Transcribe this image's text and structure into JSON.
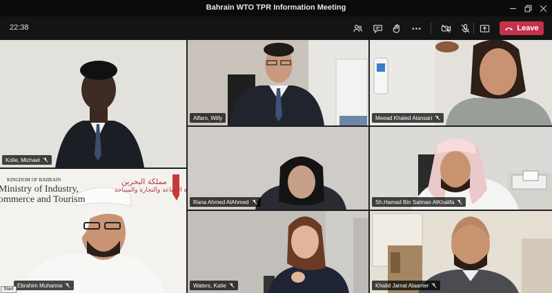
{
  "window": {
    "title": "Bahrain WTO TPR Information Meeting"
  },
  "toolbar": {
    "clock": "22:38",
    "leave_label": "Leave",
    "icons": [
      "people-icon",
      "chat-icon",
      "raise-hand-icon",
      "more-icon",
      "camera-off-icon",
      "mic-off-icon",
      "share-screen-icon",
      "phone-icon"
    ],
    "leave_color": "#c4314b"
  },
  "participants": [
    {
      "name": "Kolie, Michael",
      "muted": true
    },
    {
      "name": "Alfaro, Willy",
      "muted": false
    },
    {
      "name": "Meead Khaled Alansari",
      "muted": true
    },
    {
      "name": "Rana Ahmed AlAhmed",
      "muted": true
    },
    {
      "name": "Sh.Hamad Bin Salman AlKhalifa",
      "muted": true
    },
    {
      "name": "Ebrahim Muhanna",
      "muted": true
    },
    {
      "name": "Waters, Katie",
      "muted": true
    },
    {
      "name": "Khalid Jamal Alaamer",
      "muted": true
    }
  ],
  "background_sign": {
    "kingdom": "KINGDOM OF BAHRAIN",
    "ministry": "Ministry of Industry, ommerce and Tourism",
    "arabic_top": "مملكة البحرين",
    "arabic_bottom": "وزارة الصناعة والتجارة والسياحة"
  },
  "tooltip": "Start"
}
